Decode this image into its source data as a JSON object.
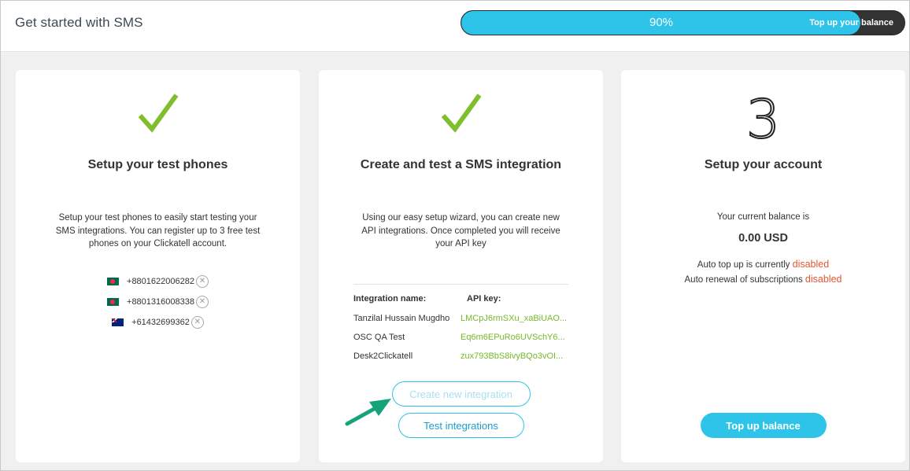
{
  "header": {
    "title": "Get started with SMS",
    "progress_percent": 90,
    "progress_text": "90%",
    "progress_action": "Top up your balance"
  },
  "colors": {
    "accent": "#2ec4ea",
    "check": "#7fbe2c",
    "key": "#76b82a",
    "warning": "#e4562f"
  },
  "phones_card": {
    "title": "Setup your test phones",
    "description": "Setup your test phones to easily start testing your SMS integrations. You can register up to 3 free test phones on your Clickatell account.",
    "phones": [
      {
        "flag": "bd-flag-icon",
        "number": "+8801622006282"
      },
      {
        "flag": "bd-flag-icon",
        "number": "+8801316008338"
      },
      {
        "flag": "au-flag-icon",
        "number": "+61432699362"
      }
    ]
  },
  "integration_card": {
    "title": "Create and test a SMS integration",
    "description": "Using our easy setup wizard, you can create new API integrations. Once completed you will receive your API key",
    "col_name": "Integration name:",
    "col_key": "API key:",
    "rows": [
      {
        "name": "Tanzilal Hussain Mugdho",
        "key": "LMCpJ6rmSXu_xaBiUAO..."
      },
      {
        "name": "OSC QA Test",
        "key": "Eq6m6EPuRo6UVSchY6..."
      },
      {
        "name": "Desk2Clickatell",
        "key": "zux793BbS8ivyBQo3vOI..."
      }
    ],
    "create_button": "Create new integration",
    "test_button": "Test integrations"
  },
  "account_card": {
    "step_number": "3",
    "title": "Setup your account",
    "balance_label": "Your current balance is",
    "balance_value": "0.00 USD",
    "auto_topup_text": "Auto top up is currently",
    "auto_topup_status": "disabled",
    "auto_renewal_text": "Auto renewal of subscriptions",
    "auto_renewal_status": "disabled",
    "topup_button": "Top up balance"
  }
}
